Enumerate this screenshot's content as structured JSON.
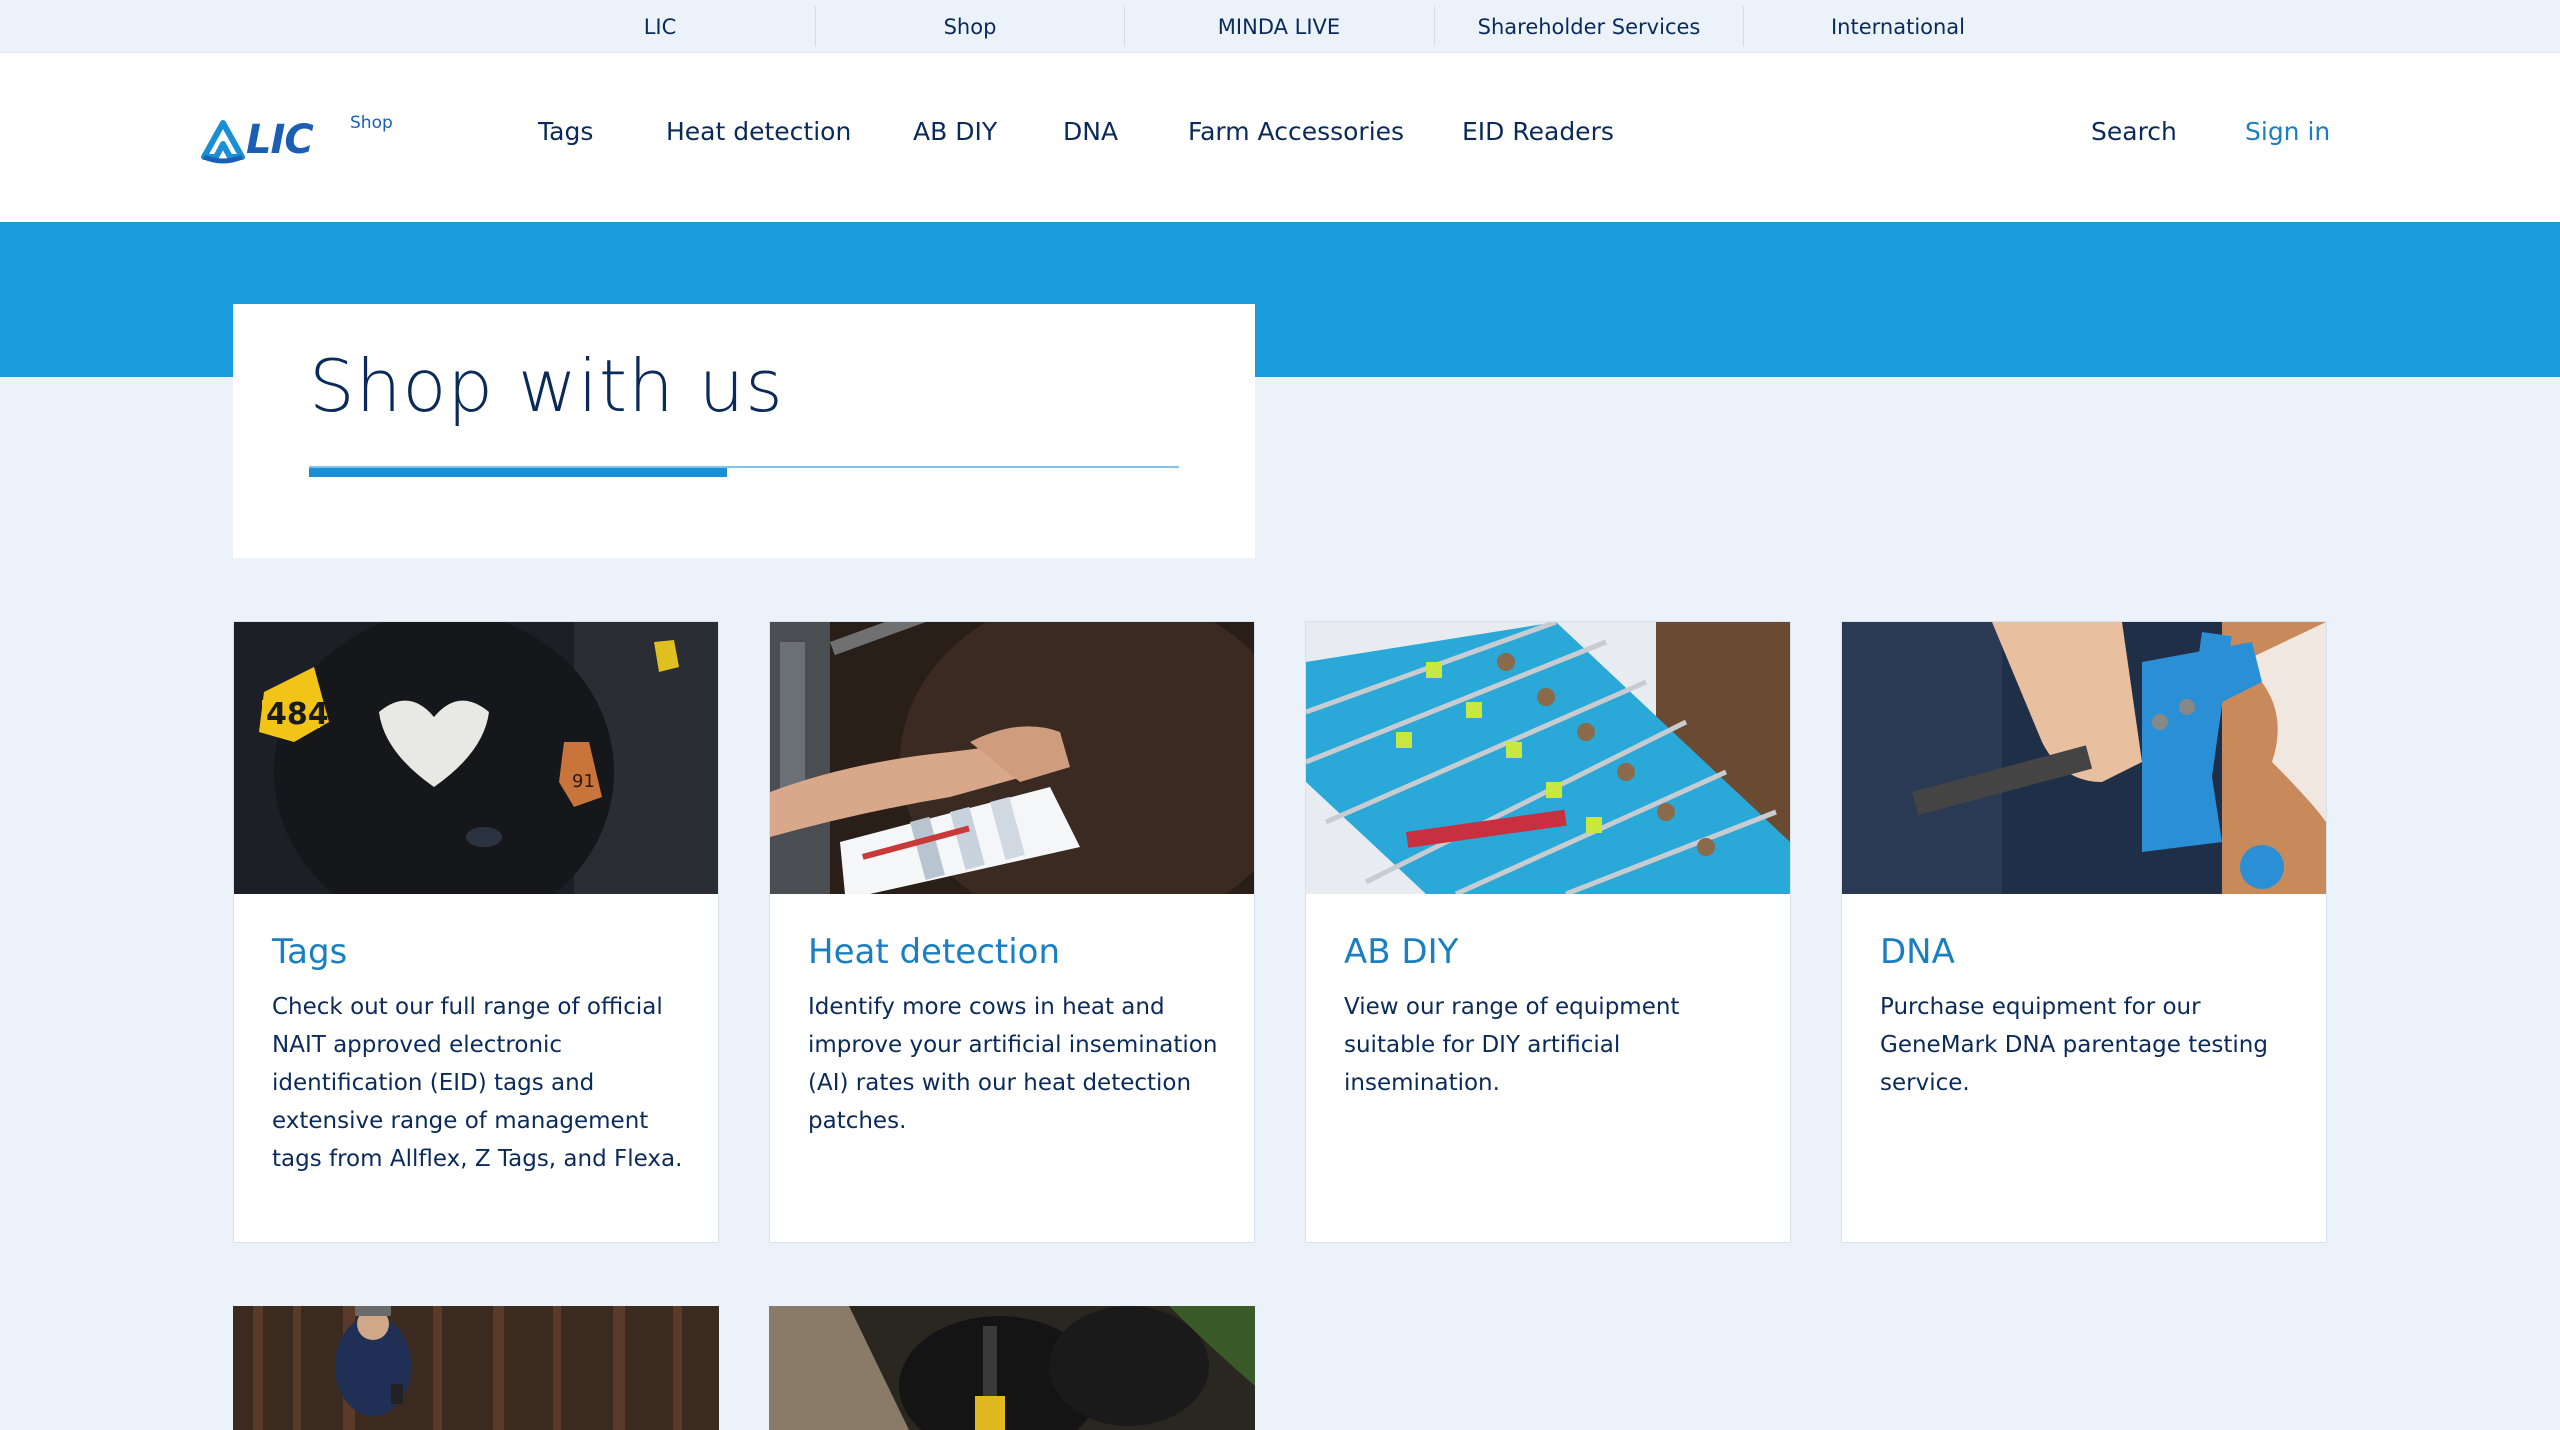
{
  "utility_bar": {
    "items": [
      "LIC",
      "Shop",
      "MINDA LIVE",
      "Shareholder Services",
      "International"
    ]
  },
  "header": {
    "logo_text": "LIC",
    "logo_sub": "Shop",
    "nav": [
      "Tags",
      "Heat detection",
      "AB DIY",
      "DNA",
      "Farm Accessories",
      "EID Readers"
    ],
    "search_label": "Search",
    "signin_label": "Sign in"
  },
  "hero": {
    "title": "Shop with us"
  },
  "products": [
    {
      "title": "Tags",
      "description": "Check out our full range of official NAIT approved electronic identification (EID) tags and extensive range of management tags from Allflex, Z Tags, and Flexa."
    },
    {
      "title": "Heat detection",
      "description": "Identify more cows in heat and improve your artificial insemination (AI) rates with our heat detection patches."
    },
    {
      "title": "AB DIY",
      "description": "View our range of equipment suitable for DIY artificial insemination."
    },
    {
      "title": "DNA",
      "description": "Purchase equipment for our GeneMark DNA parentage testing service."
    }
  ],
  "colors": {
    "brand_blue": "#1a9bdb",
    "navy": "#0a2a5a",
    "link_blue": "#1a7fc1",
    "page_bg": "#ebf2fa"
  }
}
